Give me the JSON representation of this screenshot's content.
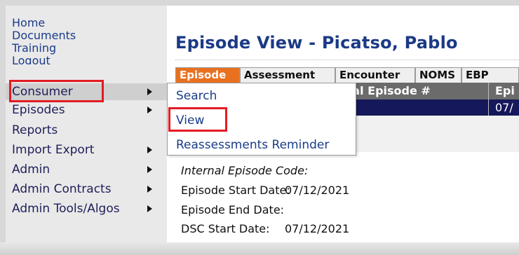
{
  "sidebar": {
    "links": [
      "Home",
      "Documents",
      "Training",
      "Logout"
    ],
    "menu": [
      {
        "label": "Consumer",
        "has_submenu": true
      },
      {
        "label": "Episodes",
        "has_submenu": true
      },
      {
        "label": "Reports",
        "has_submenu": false
      },
      {
        "label": "Import Export",
        "has_submenu": true
      },
      {
        "label": "Admin",
        "has_submenu": true
      },
      {
        "label": "Admin Contracts",
        "has_submenu": true
      },
      {
        "label": "Admin Tools/Algos",
        "has_submenu": true
      }
    ]
  },
  "page": {
    "title": "Episode View - Picatso, Pablo"
  },
  "tabs": [
    "Episode",
    "Assessment",
    "Encounter",
    "NOMS",
    "EBP"
  ],
  "table": {
    "headers": [
      "rnal Episode #",
      "Epi"
    ],
    "row": [
      "",
      "07/"
    ]
  },
  "details": [
    {
      "label": "Internal Episode Code:",
      "value": ""
    },
    {
      "label": "Episode Start Date:",
      "value": "07/12/2021"
    },
    {
      "label": "Episode End Date:",
      "value": ""
    },
    {
      "label": "DSC Start Date:",
      "value": "07/12/2021"
    }
  ],
  "submenu": {
    "items": [
      "Search",
      "View",
      "Reassessments Reminder"
    ]
  },
  "colors": {
    "highlight_box": "#e31b23",
    "active_tab": "#e8711f",
    "title": "#1b3a86",
    "selected_row": "#15185a"
  }
}
